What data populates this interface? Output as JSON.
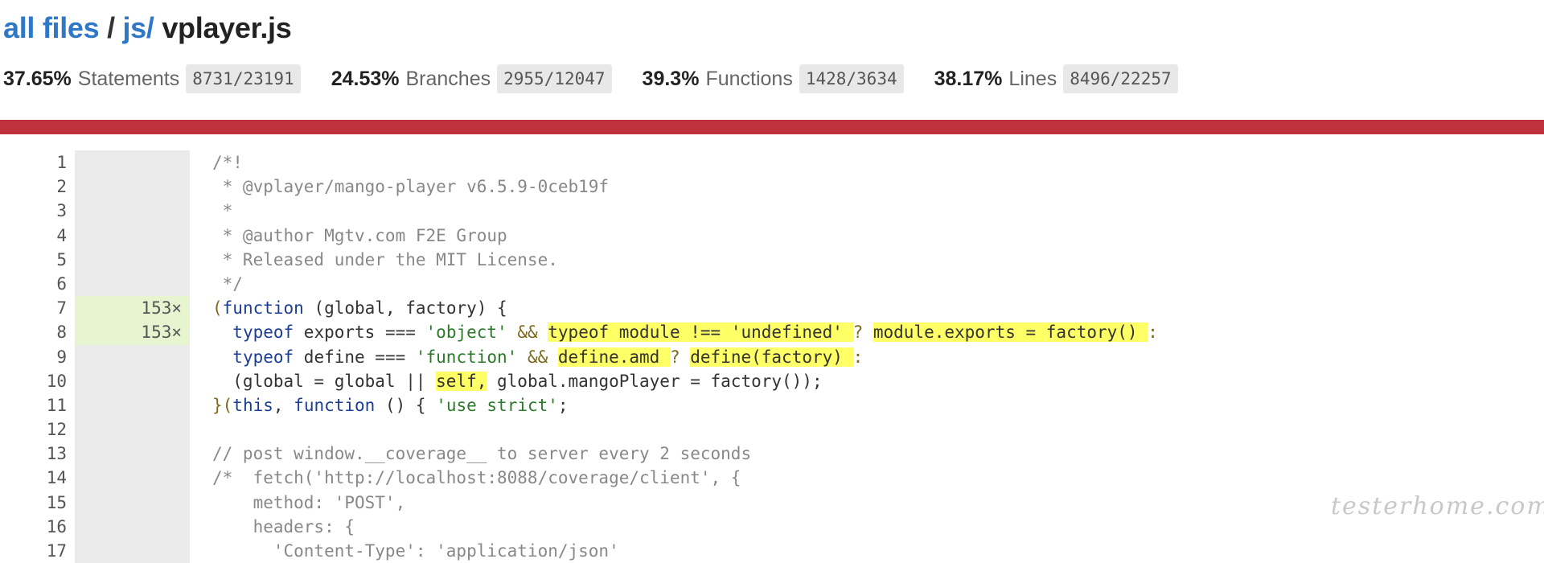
{
  "breadcrumb": {
    "root": "all files",
    "sep1": " / ",
    "dir": "js/",
    "sep2": " ",
    "file": "vplayer.js"
  },
  "stats": [
    {
      "pct": "37.65%",
      "label": "Statements",
      "fraction": "8731/23191"
    },
    {
      "pct": "24.53%",
      "label": "Branches",
      "fraction": "2955/12047"
    },
    {
      "pct": "39.3%",
      "label": "Functions",
      "fraction": "1428/3634"
    },
    {
      "pct": "38.17%",
      "label": "Lines",
      "fraction": "8496/22257"
    }
  ],
  "colors": {
    "status_bar": "#c0313e",
    "link": "#2e78c7",
    "hit_bg": "#e6f5d0",
    "uncovered_highlight": "#ffff66"
  },
  "lines": [
    {
      "n": "1",
      "hits": ""
    },
    {
      "n": "2",
      "hits": ""
    },
    {
      "n": "3",
      "hits": ""
    },
    {
      "n": "4",
      "hits": ""
    },
    {
      "n": "5",
      "hits": ""
    },
    {
      "n": "6",
      "hits": ""
    },
    {
      "n": "7",
      "hits": "153×"
    },
    {
      "n": "8",
      "hits": "153×"
    },
    {
      "n": "9",
      "hits": ""
    },
    {
      "n": "10",
      "hits": ""
    },
    {
      "n": "11",
      "hits": ""
    },
    {
      "n": "12",
      "hits": ""
    },
    {
      "n": "13",
      "hits": ""
    },
    {
      "n": "14",
      "hits": ""
    },
    {
      "n": "15",
      "hits": ""
    },
    {
      "n": "16",
      "hits": ""
    },
    {
      "n": "17",
      "hits": ""
    }
  ],
  "code": {
    "l1": "/*!",
    "l2": " * @vplayer/mango-player v6.5.9-0ceb19f",
    "l3": " *",
    "l4": " * @author Mgtv.com F2E Group",
    "l5": " * Released under the MIT License.",
    "l6": " */",
    "l7": {
      "a": "(",
      "b": "function",
      "c": " (global, factory) {"
    },
    "l8": {
      "a": "  ",
      "b": "typeof",
      "c": " exports === ",
      "d": "'object'",
      "e": " && ",
      "f": "typeof module !== 'undefined' ",
      "g": "? ",
      "h": "module.exports = factory() ",
      "i": ":"
    },
    "l9": {
      "a": "  ",
      "b": "typeof",
      "c": " define === ",
      "d": "'function'",
      "e": " && ",
      "f": "define.amd ",
      "g": "? ",
      "h": "define(factory) ",
      "i": ":"
    },
    "l10": {
      "a": "  (global = global || ",
      "b": "self,",
      "c": " global.mangoPlayer = factory());"
    },
    "l11": {
      "a": "}(",
      "b": "this",
      "c": ", ",
      "d": "function",
      "e": " () { ",
      "f": "'use strict'",
      "g": ";"
    },
    "l12": "",
    "l13": "// post window.__coverage__ to server every 2 seconds",
    "l14": "/*  fetch('http://localhost:8088/coverage/client', {",
    "l15": "    method: 'POST',",
    "l16": "    headers: {",
    "l17": "      'Content-Type': 'application/json'"
  },
  "watermark": "testerhome.com"
}
